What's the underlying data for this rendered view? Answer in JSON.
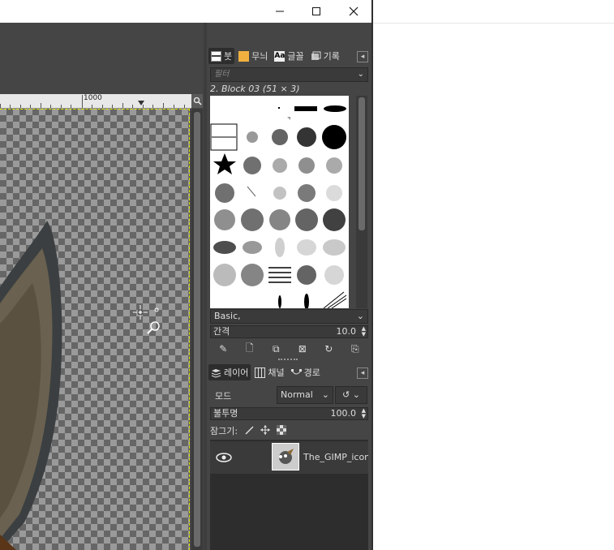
{
  "window": {
    "minimize_icon": "minimize-icon",
    "maximize_icon": "maximize-icon",
    "close_icon": "close-icon"
  },
  "canvas": {
    "ruler_label": "1000"
  },
  "brushes_dock": {
    "tabs": [
      {
        "label": "붓",
        "icon": "brush-tab-icon"
      },
      {
        "label": "무늬",
        "icon": "pattern-tab-icon"
      },
      {
        "label": "글꼴",
        "icon": "font-tab-icon"
      },
      {
        "label": "기록",
        "icon": "history-tab-icon"
      }
    ],
    "filter_placeholder": "필터",
    "selected_brush": "2. Block 03 (51 × 3)",
    "tag": "Basic,",
    "spacing_label": "간격",
    "spacing_value": "10.0"
  },
  "layers_dock": {
    "tabs": [
      {
        "label": "레이어",
        "icon": "layers-tab-icon"
      },
      {
        "label": "채널",
        "icon": "channels-tab-icon"
      },
      {
        "label": "경로",
        "icon": "paths-tab-icon"
      }
    ],
    "mode_label": "모드",
    "mode_value": "Normal",
    "opacity_label": "불투명",
    "opacity_value": "100.0",
    "lock_label": "잠그기:",
    "layer_name": "The_GIMP_icon"
  },
  "colors": {
    "panel_bg": "#454545",
    "selection_yellow": "#e9e900"
  }
}
